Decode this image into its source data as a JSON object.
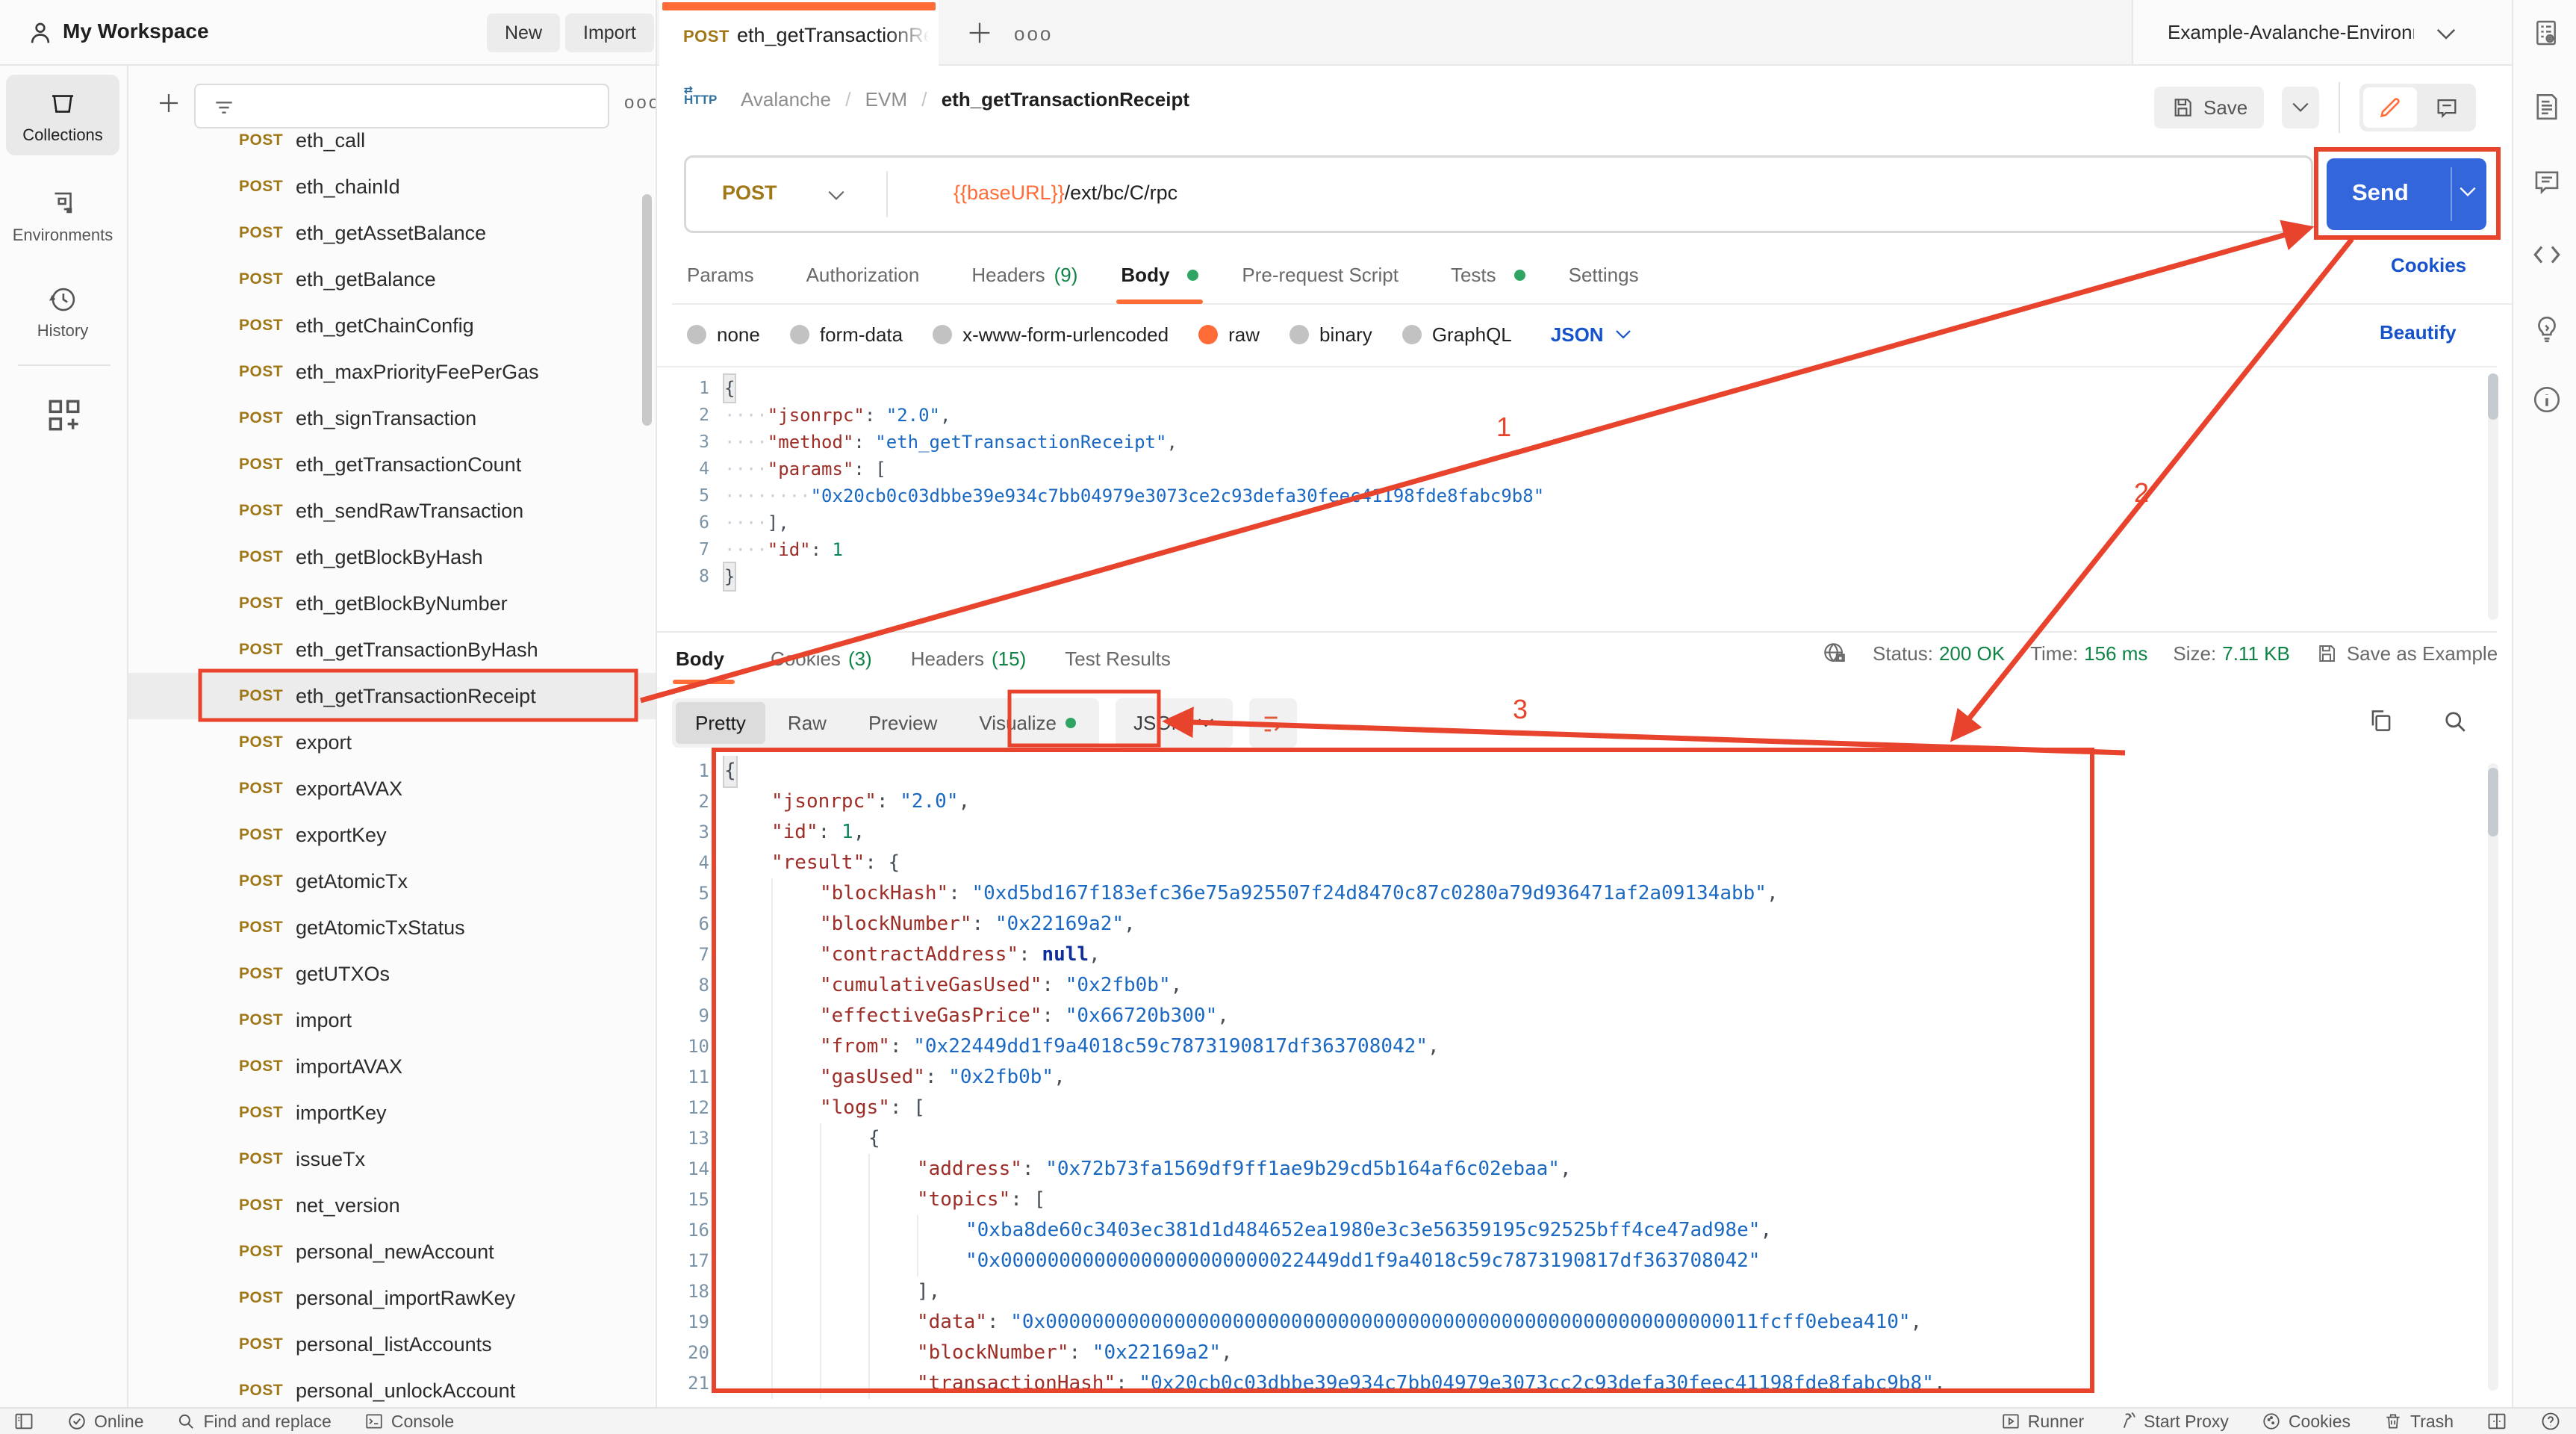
{
  "header": {
    "workspace": "My Workspace",
    "new_label": "New",
    "import_label": "Import",
    "tab": {
      "method": "POST",
      "label": "eth_getTransactionRece"
    },
    "environment": "Example-Avalanche-Environme"
  },
  "left_rail": {
    "collections": "Collections",
    "environments": "Environments",
    "history": "History"
  },
  "sidebar": {
    "items": [
      {
        "method": "POST",
        "name": "eth_call"
      },
      {
        "method": "POST",
        "name": "eth_chainId"
      },
      {
        "method": "POST",
        "name": "eth_getAssetBalance"
      },
      {
        "method": "POST",
        "name": "eth_getBalance"
      },
      {
        "method": "POST",
        "name": "eth_getChainConfig"
      },
      {
        "method": "POST",
        "name": "eth_maxPriorityFeePerGas"
      },
      {
        "method": "POST",
        "name": "eth_signTransaction"
      },
      {
        "method": "POST",
        "name": "eth_getTransactionCount"
      },
      {
        "method": "POST",
        "name": "eth_sendRawTransaction"
      },
      {
        "method": "POST",
        "name": "eth_getBlockByHash"
      },
      {
        "method": "POST",
        "name": "eth_getBlockByNumber"
      },
      {
        "method": "POST",
        "name": "eth_getTransactionByHash"
      },
      {
        "method": "POST",
        "name": "eth_getTransactionReceipt",
        "selected": true
      },
      {
        "method": "POST",
        "name": "export"
      },
      {
        "method": "POST",
        "name": "exportAVAX"
      },
      {
        "method": "POST",
        "name": "exportKey"
      },
      {
        "method": "POST",
        "name": "getAtomicTx"
      },
      {
        "method": "POST",
        "name": "getAtomicTxStatus"
      },
      {
        "method": "POST",
        "name": "getUTXOs"
      },
      {
        "method": "POST",
        "name": "import"
      },
      {
        "method": "POST",
        "name": "importAVAX"
      },
      {
        "method": "POST",
        "name": "importKey"
      },
      {
        "method": "POST",
        "name": "issueTx"
      },
      {
        "method": "POST",
        "name": "net_version"
      },
      {
        "method": "POST",
        "name": "personal_newAccount"
      },
      {
        "method": "POST",
        "name": "personal_importRawKey"
      },
      {
        "method": "POST",
        "name": "personal_listAccounts"
      },
      {
        "method": "POST",
        "name": "personal_unlockAccount"
      }
    ]
  },
  "request": {
    "breadcrumb": {
      "part1": "Avalanche",
      "sep": "/",
      "part2": "EVM",
      "current": "eth_getTransactionReceipt"
    },
    "save_label": "Save",
    "method": "POST",
    "url_var": "{{baseURL}}",
    "url_path": "/ext/bc/C/rpc",
    "send_label": "Send",
    "cookies_link": "Cookies",
    "beautify_link": "Beautify",
    "tabs": [
      {
        "label": "Params"
      },
      {
        "label": "Authorization"
      },
      {
        "label": "Headers",
        "count": "(9)"
      },
      {
        "label": "Body",
        "dot": true,
        "active": true
      },
      {
        "label": "Pre-request Script"
      },
      {
        "label": "Tests",
        "dot": true
      },
      {
        "label": "Settings"
      }
    ],
    "body_types": [
      {
        "label": "none"
      },
      {
        "label": "form-data"
      },
      {
        "label": "x-www-form-urlencoded"
      },
      {
        "label": "raw",
        "selected": true
      },
      {
        "label": "binary"
      },
      {
        "label": "GraphQL"
      }
    ],
    "language": "JSON",
    "code": [
      {
        "n": 1,
        "t": [
          [
            "m",
            "{"
          ]
        ]
      },
      {
        "n": 2,
        "t": [
          [
            "w",
            "····"
          ],
          [
            "k",
            "\"jsonrpc\""
          ],
          [
            "p",
            ": "
          ],
          [
            "s",
            "\"2.0\""
          ],
          [
            "p",
            ","
          ]
        ]
      },
      {
        "n": 3,
        "t": [
          [
            "w",
            "····"
          ],
          [
            "k",
            "\"method\""
          ],
          [
            "p",
            ": "
          ],
          [
            "s",
            "\"eth_getTransactionReceipt\""
          ],
          [
            "p",
            ","
          ]
        ]
      },
      {
        "n": 4,
        "t": [
          [
            "w",
            "····"
          ],
          [
            "k",
            "\"params\""
          ],
          [
            "p",
            ": ["
          ]
        ]
      },
      {
        "n": 5,
        "t": [
          [
            "w",
            "····"
          ],
          [
            "w",
            "····"
          ],
          [
            "s",
            "\"0x20cb0c03dbbe39e934c7bb04979e3073ce2c93defa30feec41198fde8fabc9b8\""
          ]
        ]
      },
      {
        "n": 6,
        "t": [
          [
            "w",
            "····"
          ],
          [
            "p",
            "],"
          ]
        ]
      },
      {
        "n": 7,
        "t": [
          [
            "w",
            "····"
          ],
          [
            "k",
            "\"id\""
          ],
          [
            "p",
            ": "
          ],
          [
            "num",
            "1"
          ]
        ]
      },
      {
        "n": 8,
        "t": [
          [
            "m",
            "}"
          ]
        ]
      }
    ]
  },
  "response": {
    "tabs": [
      {
        "label": "Body",
        "active": true
      },
      {
        "label": "Cookies",
        "count": "(3)"
      },
      {
        "label": "Headers",
        "count": "(15)"
      },
      {
        "label": "Test Results"
      }
    ],
    "meta": [
      {
        "label": "Status:",
        "value": "200 OK"
      },
      {
        "label": "Time:",
        "value": "156 ms"
      },
      {
        "label": "Size:",
        "value": "7.11 KB"
      }
    ],
    "save_as_example": "Save as Example",
    "view_tabs": [
      {
        "label": "Pretty",
        "active": true
      },
      {
        "label": "Raw"
      },
      {
        "label": "Preview"
      },
      {
        "label": "Visualize",
        "dot": true
      }
    ],
    "language": "JSON",
    "code": [
      {
        "n": 1,
        "t": [
          [
            "m",
            "{"
          ]
        ]
      },
      {
        "n": 2,
        "t": [
          [
            "sp",
            ""
          ],
          [
            "k",
            "\"jsonrpc\""
          ],
          [
            "p",
            ": "
          ],
          [
            "s",
            "\"2.0\""
          ],
          [
            "p",
            ","
          ]
        ]
      },
      {
        "n": 3,
        "t": [
          [
            "sp",
            ""
          ],
          [
            "k",
            "\"id\""
          ],
          [
            "p",
            ": "
          ],
          [
            "num",
            "1"
          ],
          [
            "p",
            ","
          ]
        ]
      },
      {
        "n": 4,
        "t": [
          [
            "sp",
            ""
          ],
          [
            "k",
            "\"result\""
          ],
          [
            "p",
            ": {"
          ]
        ]
      },
      {
        "n": 5,
        "t": [
          [
            "sp",
            ""
          ],
          [
            "g",
            ""
          ],
          [
            "k",
            "\"blockHash\""
          ],
          [
            "p",
            ": "
          ],
          [
            "s",
            "\"0xd5bd167f183efc36e75a925507f24d8470c87c0280a79d936471af2a09134abb\""
          ],
          [
            "p",
            ","
          ]
        ]
      },
      {
        "n": 6,
        "t": [
          [
            "sp",
            ""
          ],
          [
            "g",
            ""
          ],
          [
            "k",
            "\"blockNumber\""
          ],
          [
            "p",
            ": "
          ],
          [
            "s",
            "\"0x22169a2\""
          ],
          [
            "p",
            ","
          ]
        ]
      },
      {
        "n": 7,
        "t": [
          [
            "sp",
            ""
          ],
          [
            "g",
            ""
          ],
          [
            "k",
            "\"contractAddress\""
          ],
          [
            "p",
            ": "
          ],
          [
            "nul",
            "null"
          ],
          [
            "p",
            ","
          ]
        ]
      },
      {
        "n": 8,
        "t": [
          [
            "sp",
            ""
          ],
          [
            "g",
            ""
          ],
          [
            "k",
            "\"cumulativeGasUsed\""
          ],
          [
            "p",
            ": "
          ],
          [
            "s",
            "\"0x2fb0b\""
          ],
          [
            "p",
            ","
          ]
        ]
      },
      {
        "n": 9,
        "t": [
          [
            "sp",
            ""
          ],
          [
            "g",
            ""
          ],
          [
            "k",
            "\"effectiveGasPrice\""
          ],
          [
            "p",
            ": "
          ],
          [
            "s",
            "\"0x66720b300\""
          ],
          [
            "p",
            ","
          ]
        ]
      },
      {
        "n": 10,
        "t": [
          [
            "sp",
            ""
          ],
          [
            "g",
            ""
          ],
          [
            "k",
            "\"from\""
          ],
          [
            "p",
            ": "
          ],
          [
            "s",
            "\"0x22449dd1f9a4018c59c7873190817df363708042\""
          ],
          [
            "p",
            ","
          ]
        ]
      },
      {
        "n": 11,
        "t": [
          [
            "sp",
            ""
          ],
          [
            "g",
            ""
          ],
          [
            "k",
            "\"gasUsed\""
          ],
          [
            "p",
            ": "
          ],
          [
            "s",
            "\"0x2fb0b\""
          ],
          [
            "p",
            ","
          ]
        ]
      },
      {
        "n": 12,
        "t": [
          [
            "sp",
            ""
          ],
          [
            "g",
            ""
          ],
          [
            "k",
            "\"logs\""
          ],
          [
            "p",
            ": ["
          ]
        ]
      },
      {
        "n": 13,
        "t": [
          [
            "sp",
            ""
          ],
          [
            "g",
            ""
          ],
          [
            "g",
            ""
          ],
          [
            "p",
            "{"
          ]
        ]
      },
      {
        "n": 14,
        "t": [
          [
            "sp",
            ""
          ],
          [
            "g",
            ""
          ],
          [
            "g",
            ""
          ],
          [
            "g",
            ""
          ],
          [
            "k",
            "\"address\""
          ],
          [
            "p",
            ": "
          ],
          [
            "s",
            "\"0x72b73fa1569df9ff1ae9b29cd5b164af6c02ebaa\""
          ],
          [
            "p",
            ","
          ]
        ]
      },
      {
        "n": 15,
        "t": [
          [
            "sp",
            ""
          ],
          [
            "g",
            ""
          ],
          [
            "g",
            ""
          ],
          [
            "g",
            ""
          ],
          [
            "k",
            "\"topics\""
          ],
          [
            "p",
            ": ["
          ]
        ]
      },
      {
        "n": 16,
        "t": [
          [
            "sp",
            ""
          ],
          [
            "g",
            ""
          ],
          [
            "g",
            ""
          ],
          [
            "g",
            ""
          ],
          [
            "g",
            ""
          ],
          [
            "s",
            "\"0xba8de60c3403ec381d1d484652ea1980e3c3e56359195c92525bff4ce47ad98e\""
          ],
          [
            "p",
            ","
          ]
        ]
      },
      {
        "n": 17,
        "t": [
          [
            "sp",
            ""
          ],
          [
            "g",
            ""
          ],
          [
            "g",
            ""
          ],
          [
            "g",
            ""
          ],
          [
            "g",
            ""
          ],
          [
            "s",
            "\"0x00000000000000000000000022449dd1f9a4018c59c7873190817df363708042\""
          ]
        ]
      },
      {
        "n": 18,
        "t": [
          [
            "sp",
            ""
          ],
          [
            "g",
            ""
          ],
          [
            "g",
            ""
          ],
          [
            "g",
            ""
          ],
          [
            "p",
            "],"
          ]
        ]
      },
      {
        "n": 19,
        "t": [
          [
            "sp",
            ""
          ],
          [
            "g",
            ""
          ],
          [
            "g",
            ""
          ],
          [
            "g",
            ""
          ],
          [
            "k",
            "\"data\""
          ],
          [
            "p",
            ": "
          ],
          [
            "s",
            "\"0x0000000000000000000000000000000000000000000000000000000000011fcff0ebea410\""
          ],
          [
            "p",
            ","
          ]
        ]
      },
      {
        "n": 20,
        "t": [
          [
            "sp",
            ""
          ],
          [
            "g",
            ""
          ],
          [
            "g",
            ""
          ],
          [
            "g",
            ""
          ],
          [
            "k",
            "\"blockNumber\""
          ],
          [
            "p",
            ": "
          ],
          [
            "s",
            "\"0x22169a2\""
          ],
          [
            "p",
            ","
          ]
        ]
      },
      {
        "n": 21,
        "t": [
          [
            "sp",
            ""
          ],
          [
            "g",
            ""
          ],
          [
            "g",
            ""
          ],
          [
            "g",
            ""
          ],
          [
            "k",
            "\"transactionHash\""
          ],
          [
            "p",
            ": "
          ],
          [
            "s",
            "\"0x20cb0c03dbbe39e934c7bb04979e3073cc2c93defa30feec41198fde8fabc9b8\""
          ],
          [
            "p",
            ","
          ]
        ]
      }
    ]
  },
  "footer": {
    "online": "Online",
    "find": "Find and replace",
    "console": "Console",
    "runner": "Runner",
    "proxy": "Start Proxy",
    "cookies": "Cookies",
    "trash": "Trash"
  },
  "annotations": {
    "color": "#e8432c",
    "labels": [
      {
        "text": "1"
      },
      {
        "text": "2"
      },
      {
        "text": "3"
      }
    ]
  },
  "icons": {
    "names": [
      "person-icon",
      "plus-icon",
      "more-options-icon",
      "chevron-down-icon",
      "env-quicklook-icon",
      "collections-icon",
      "environments-icon",
      "history-icon",
      "grid-add-icon",
      "filter-icon",
      "http-icon",
      "save-icon",
      "pencil-icon",
      "comment-icon",
      "doc-icon",
      "code-icon",
      "bulb-icon",
      "info-icon",
      "globe-lock-icon",
      "copy-icon",
      "search-icon",
      "wrap-lines-icon",
      "check-circle-icon",
      "console-icon",
      "runner-icon",
      "proxy-icon",
      "cookie-icon",
      "trash-icon",
      "split-panel-icon",
      "help-icon",
      "sidebar-toggle-icon"
    ]
  }
}
